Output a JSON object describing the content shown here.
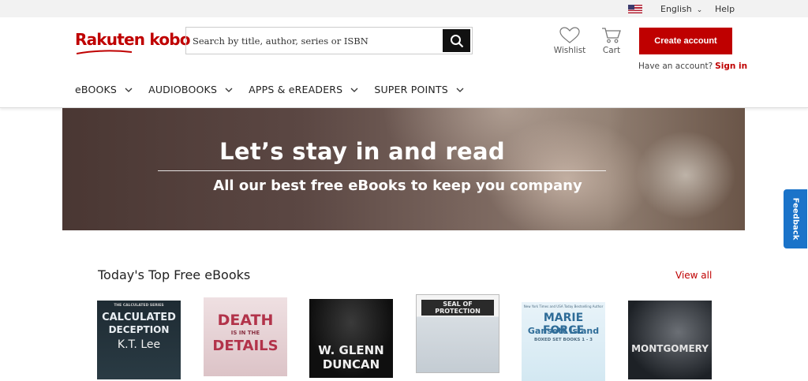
{
  "topbar": {
    "language": "English",
    "help": "Help",
    "flag_icon": "us-flag-icon"
  },
  "brand": {
    "logo_text": "Rakuten kobo",
    "accent_color": "#bf0000"
  },
  "search": {
    "placeholder": "Search by title, author, series or ISBN",
    "value": ""
  },
  "header": {
    "wishlist_label": "Wishlist",
    "cart_label": "Cart",
    "create_account": "Create account",
    "have_account": "Have an account?",
    "sign_in": "Sign in"
  },
  "nav": {
    "items": [
      {
        "label": "eBOOKS"
      },
      {
        "label": "AUDIOBOOKS"
      },
      {
        "label": "APPS & eREADERS"
      },
      {
        "label": "SUPER POINTS"
      }
    ]
  },
  "hero": {
    "title": "Let’s stay in and read",
    "subtitle": "All our best free eBooks to keep you company"
  },
  "feedback": {
    "label": "Feedback",
    "color": "#1a73c9"
  },
  "section": {
    "title": "Today's Top Free eBooks",
    "view_all": "View all",
    "books": [
      {
        "cover_lines": [
          "THE CALCULATED SERIES",
          "CALCULATED",
          "DECEPTION",
          "K.T. Lee"
        ]
      },
      {
        "cover_lines": [
          "DEATH",
          "IS IN THE",
          "DETAILS"
        ]
      },
      {
        "cover_lines": [
          "W. GLENN",
          "DUNCAN"
        ]
      },
      {
        "cover_lines": [
          "SEAL OF",
          "PROTECTION"
        ]
      },
      {
        "cover_lines": [
          "New York Times and USA Today Bestselling Author",
          "MARIE FORCE",
          "Gansett Island",
          "BOXED SET BOOKS 1 - 3"
        ]
      },
      {
        "cover_lines": [
          "MONTGOMERY"
        ]
      }
    ]
  }
}
